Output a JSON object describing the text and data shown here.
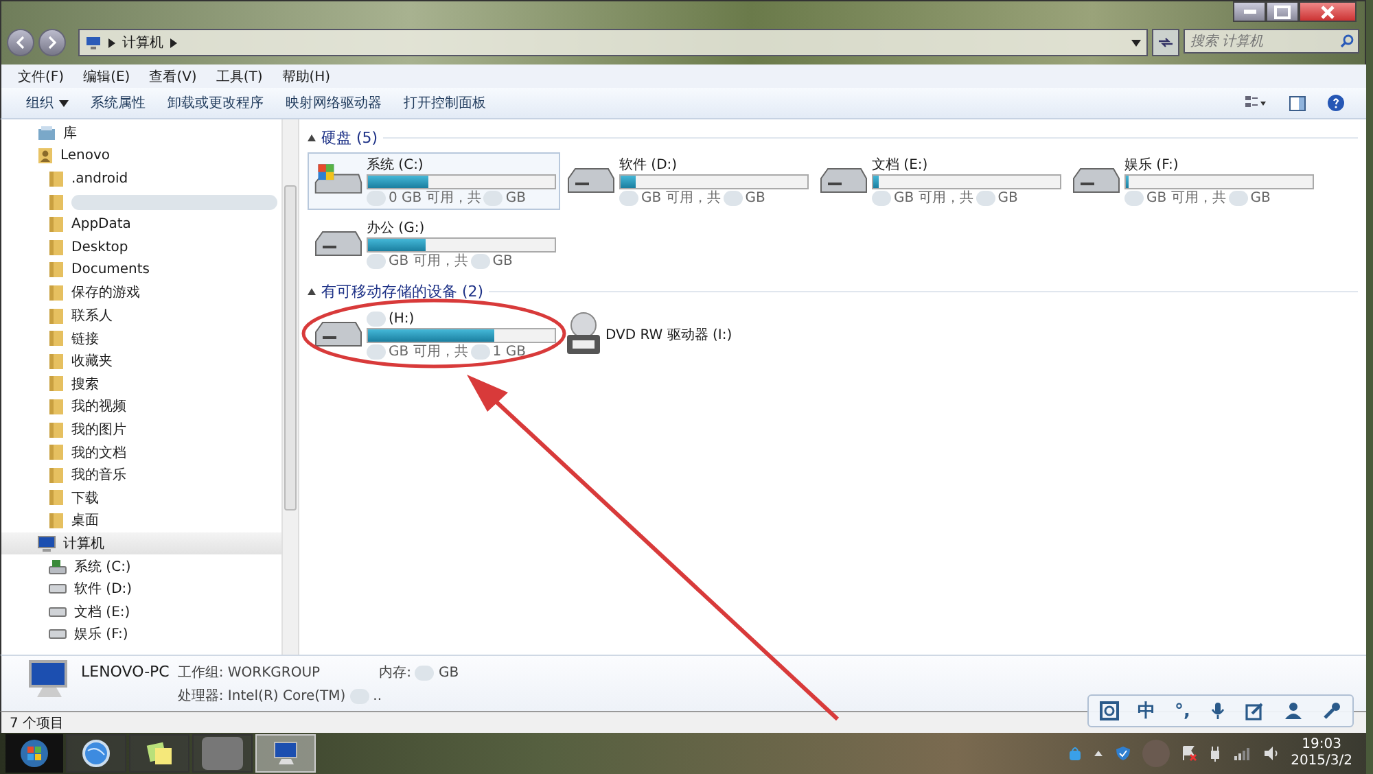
{
  "window": {
    "address": [
      "计算机"
    ],
    "search": {
      "placeholder": "搜索 计算机"
    }
  },
  "menu": [
    "文件(F)",
    "编辑(E)",
    "查看(V)",
    "工具(T)",
    "帮助(H)"
  ],
  "toolbar": [
    {
      "label": "组织",
      "dropdown": true
    },
    {
      "label": "系统属性",
      "dropdown": false
    },
    {
      "label": "卸载或更改程序",
      "dropdown": false
    },
    {
      "label": "映射网络驱动器",
      "dropdown": false
    },
    {
      "label": "打开控制面板",
      "dropdown": false
    }
  ],
  "sidebar": {
    "items": [
      {
        "label": "库",
        "kind": "library",
        "selected": false
      },
      {
        "label": "Lenovo",
        "kind": "user",
        "selected": false,
        "children": [
          {
            "label": ".android",
            "kind": "folder",
            "selected": false
          },
          {
            "kind": "redacted",
            "selected": false
          },
          {
            "label": "AppData",
            "kind": "folder",
            "selected": false
          },
          {
            "label": "Desktop",
            "kind": "folder",
            "selected": false
          },
          {
            "label": "Documents",
            "kind": "folder",
            "selected": false
          },
          {
            "label": "保存的游戏",
            "kind": "folder",
            "selected": false
          },
          {
            "label": "联系人",
            "kind": "folder",
            "selected": false
          },
          {
            "label": "链接",
            "kind": "folder",
            "selected": false
          },
          {
            "label": "收藏夹",
            "kind": "folder",
            "selected": false
          },
          {
            "label": "搜索",
            "kind": "folder",
            "selected": false
          },
          {
            "label": "我的视频",
            "kind": "folder",
            "selected": false
          },
          {
            "label": "我的图片",
            "kind": "folder",
            "selected": false
          },
          {
            "label": "我的文档",
            "kind": "folder",
            "selected": false
          },
          {
            "label": "我的音乐",
            "kind": "folder",
            "selected": false
          },
          {
            "label": "下载",
            "kind": "folder",
            "selected": false
          },
          {
            "label": "桌面",
            "kind": "folder",
            "selected": false
          }
        ]
      },
      {
        "label": "计算机",
        "kind": "computer",
        "selected": true,
        "children": [
          {
            "label": "系统 (C:)",
            "kind": "system",
            "selected": false
          },
          {
            "label": "软件 (D:)",
            "kind": "drive",
            "selected": false
          },
          {
            "label": "文档 (E:)",
            "kind": "drive",
            "selected": false
          },
          {
            "label": "娱乐 (F:)",
            "kind": "drive",
            "selected": false
          }
        ]
      }
    ]
  },
  "groups": [
    {
      "title": "硬盘 (5)",
      "expanded": true,
      "drives": [
        {
          "name": "系统 (C:)",
          "kind": "system",
          "selected": true,
          "level": 0.32,
          "free": "0 GB 可用，共",
          "total": "GB"
        },
        {
          "name": "软件 (D:)",
          "kind": "disk",
          "selected": false,
          "level": 0.08,
          "free": "GB 可用，共",
          "total": "GB"
        },
        {
          "name": "文档 (E:)",
          "kind": "disk",
          "selected": false,
          "level": 0.03,
          "free": "GB 可用，共",
          "total": "GB"
        },
        {
          "name": "娱乐 (F:)",
          "kind": "disk",
          "selected": false,
          "level": 0,
          "free": "GB 可用，共",
          "total": "GB"
        },
        {
          "name": "办公 (G:)",
          "kind": "disk",
          "selected": false,
          "level": 0.31,
          "free": "GB 可用，共",
          "total": "GB"
        }
      ]
    },
    {
      "title": "有可移动存储的设备 (2)",
      "expanded": true,
      "drives": [
        {
          "name": "(H:)",
          "kind": "removable",
          "selected": false,
          "level": 0.68,
          "free": "GB 可用，共",
          "total": "1 GB"
        },
        {
          "name": "DVD RW 驱动器 (I:)",
          "kind": "dvd",
          "selected": false
        }
      ]
    }
  ],
  "details": {
    "name": "LENOVO-PC",
    "workgroup": "工作组: WORKGROUP",
    "memory": "内存:",
    "memory_unit": "GB",
    "cpu": "处理器: Intel(R) Core(TM)",
    "cpu_tail": ".."
  },
  "status_bar": "7 个项目",
  "language_bar": {
    "ime": "中",
    "punct": "°,"
  },
  "taskbar": {
    "apps": [
      {
        "kind": "ie",
        "selected": false
      },
      {
        "kind": "notes",
        "selected": false
      },
      {
        "kind": "blurred",
        "selected": false
      },
      {
        "kind": "explorer",
        "selected": true
      }
    ]
  },
  "clock": {
    "time": "19:03",
    "date": "2015/3/2"
  }
}
